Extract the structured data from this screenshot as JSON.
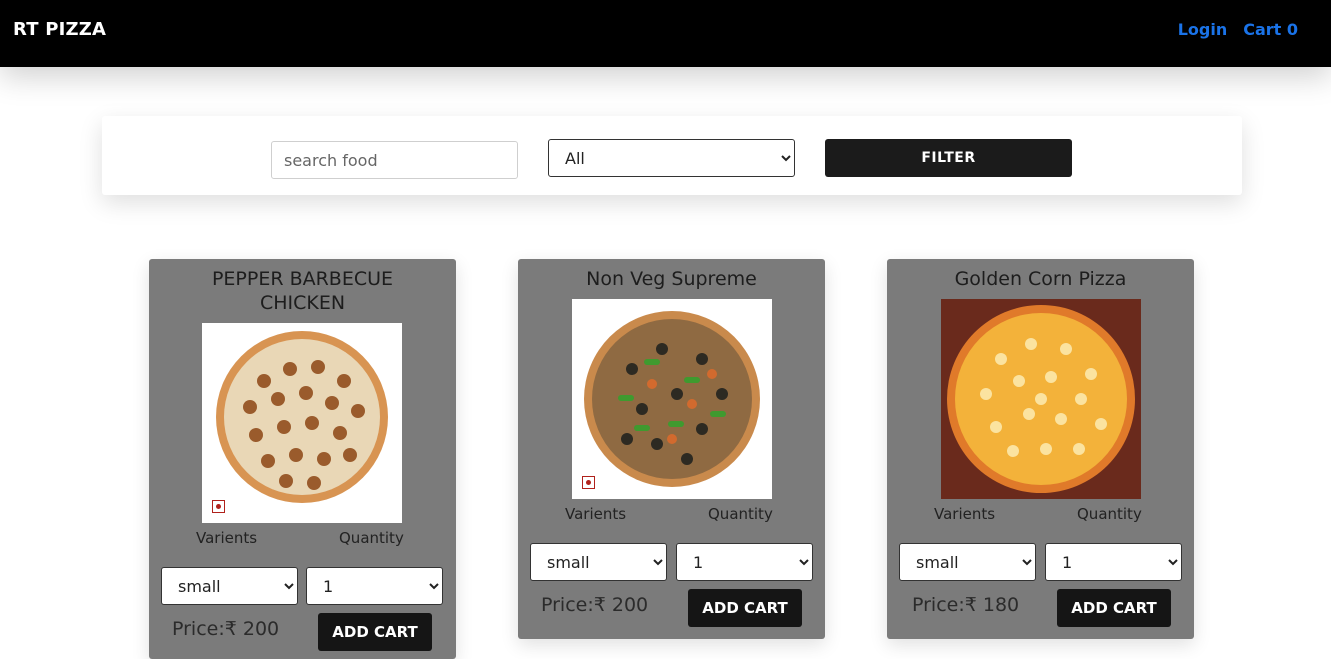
{
  "navbar": {
    "brand": "RT PIZZA",
    "login": "Login",
    "cart": "Cart 0"
  },
  "filter": {
    "search_placeholder": "search food",
    "category_selected": "All",
    "button_label": "FILTER"
  },
  "labels": {
    "varients": "Varients",
    "quantity": "Quantity",
    "add_cart": "ADD CART"
  },
  "pizzas": [
    {
      "name": "PEPPER BARBECUE",
      "name_line2": "CHICKEN",
      "variant": "small",
      "quantity": "1",
      "price": "Price:₹ 200",
      "veg_mark": "non-veg-icon"
    },
    {
      "name": "Non Veg Supreme",
      "variant": "small",
      "quantity": "1",
      "price": "Price:₹ 200",
      "veg_mark": "non-veg-icon"
    },
    {
      "name": "Golden Corn Pizza",
      "variant": "small",
      "quantity": "1",
      "price": "Price:₹ 180"
    }
  ],
  "colors": {
    "navbar_bg": "#000000",
    "link": "#1a73e8",
    "card_bg": "#7b7b7b",
    "button_bg": "#151515"
  }
}
